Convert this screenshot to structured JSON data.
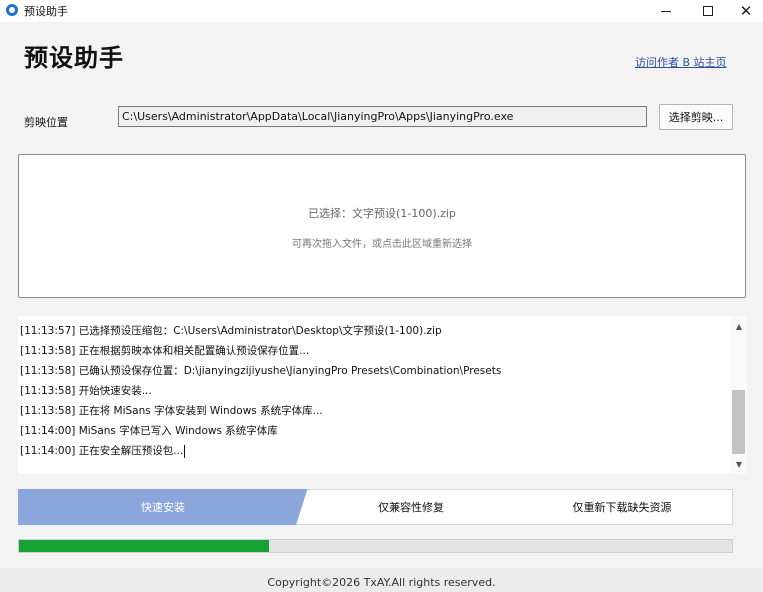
{
  "window": {
    "title": "预设助手",
    "minimize_icon": "minimize-icon",
    "maximize_icon": "maximize-icon",
    "close_glyph": "✕"
  },
  "header": {
    "title": "预设助手",
    "author_link": "访问作者 B 站主页"
  },
  "path_row": {
    "label": "剪映位置",
    "value": "C:\\Users\\Administrator\\AppData\\Local\\JianyingPro\\Apps\\JianyingPro.exe",
    "button": "选择剪映..."
  },
  "drop_zone": {
    "selected": "已选择：文字预设(1-100).zip",
    "hint": "可再次拖入文件，或点击此区域重新选择"
  },
  "log": [
    "[11:13:57] 已选择预设压缩包：C:\\Users\\Administrator\\Desktop\\文字预设(1-100).zip",
    "[11:13:58] 正在根据剪映本体和相关配置确认预设保存位置...",
    "[11:13:58] 已确认预设保存位置：D:\\jianyingzijiyushe\\JianyingPro Presets\\Combination\\Presets",
    "[11:13:58] 开始快速安装...",
    "[11:13:58] 正在将 MiSans 字体安装到 Windows 系统字体库...",
    "[11:14:00] MiSans 字体已写入 Windows 系统字体库",
    "[11:14:00] 正在安全解压预设包..."
  ],
  "scroll": {
    "up": "▲",
    "down": "▼"
  },
  "modes": {
    "quick": "快速安装",
    "compat": "仅兼容性修复",
    "redownload": "仅重新下载缺失资源",
    "active": "quick"
  },
  "progress": {
    "percent": 35
  },
  "colors": {
    "accent": "#8aa6dc",
    "progress": "#16a334",
    "link": "#2f4f9a"
  },
  "footer": "Copyright©2026 TxAY.All rights reserved."
}
